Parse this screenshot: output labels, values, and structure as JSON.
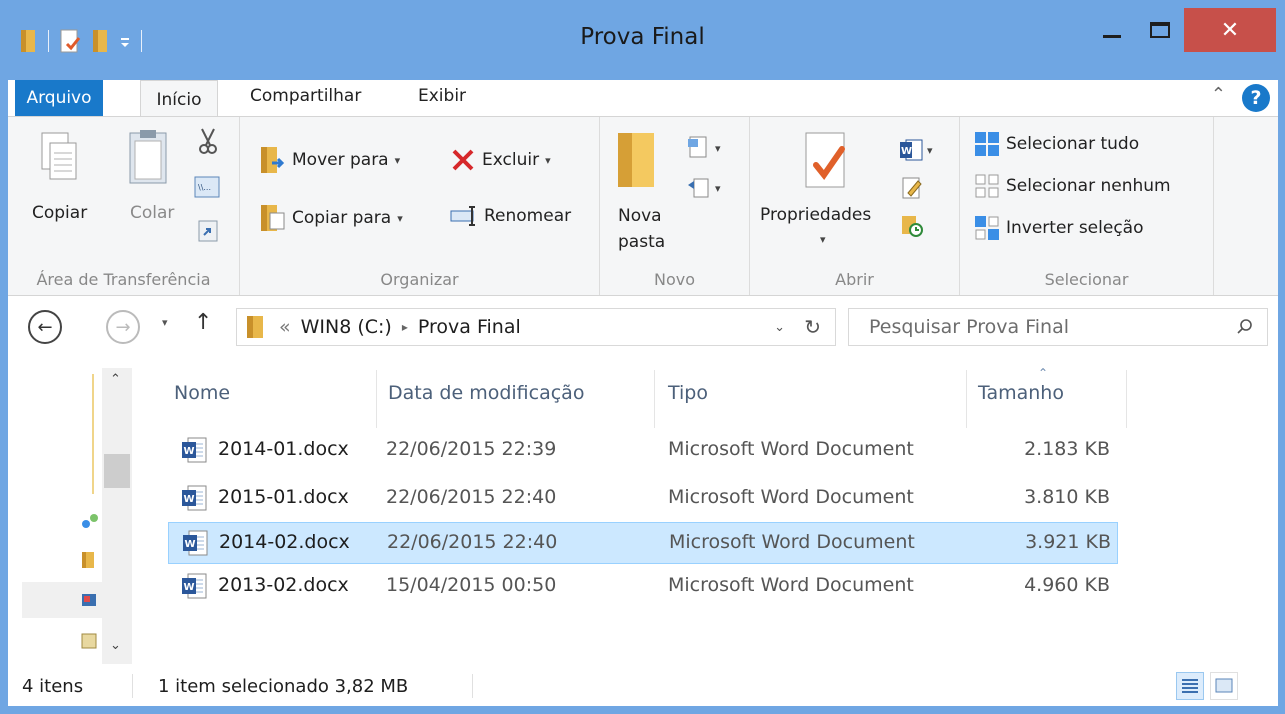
{
  "window": {
    "title": "Prova Final",
    "close_glyph": "✕"
  },
  "ribbon_tabs": {
    "file": "Arquivo",
    "home": "Início",
    "share": "Compartilhar",
    "view": "Exibir"
  },
  "clipboard": {
    "copy": "Copiar",
    "paste": "Colar",
    "group_label": "Área de Transferência"
  },
  "organize": {
    "move_to": "Mover para",
    "copy_to": "Copiar para",
    "delete": "Excluir",
    "rename": "Renomear",
    "group_label": "Organizar"
  },
  "new_group": {
    "new_folder_line1": "Nova",
    "new_folder_line2": "pasta",
    "group_label": "Novo"
  },
  "open_group": {
    "properties": "Propriedades",
    "group_label": "Abrir"
  },
  "select_group": {
    "select_all": "Selecionar tudo",
    "select_none": "Selecionar nenhum",
    "invert": "Inverter seleção",
    "group_label": "Selecionar"
  },
  "address": {
    "prefix": "«",
    "drive": "WIN8 (C:)",
    "separator": "▸",
    "folder": "Prova Final",
    "search_placeholder": "Pesquisar Prova Final"
  },
  "columns": {
    "name": "Nome",
    "date": "Data de modificação",
    "type": "Tipo",
    "size": "Tamanho"
  },
  "files": [
    {
      "name": "2014-01.docx",
      "date": "22/06/2015 22:39",
      "type": "Microsoft Word Document",
      "size": "2.183 KB",
      "selected": false
    },
    {
      "name": "2015-01.docx",
      "date": "22/06/2015 22:40",
      "type": "Microsoft Word Document",
      "size": "3.810 KB",
      "selected": false
    },
    {
      "name": "2014-02.docx",
      "date": "22/06/2015 22:40",
      "type": "Microsoft Word Document",
      "size": "3.921 KB",
      "selected": true
    },
    {
      "name": "2013-02.docx",
      "date": "15/04/2015 00:50",
      "type": "Microsoft Word Document",
      "size": "4.960 KB",
      "selected": false
    }
  ],
  "status": {
    "count": "4 itens",
    "selection": "1 item selecionado  3,82 MB"
  },
  "colors": {
    "titlebar": "#6fa6e3",
    "file_tab": "#1979ca",
    "close": "#c7504a",
    "selection": "#cce8ff"
  },
  "icons": [
    "folder-icon",
    "properties-icon",
    "new-folder-icon",
    "undo-icon",
    "dropdown-icon",
    "copy-icon",
    "paste-icon",
    "cut-icon",
    "copy-path-icon",
    "paste-shortcut-icon",
    "move-to-icon",
    "copy-to-icon",
    "delete-icon",
    "rename-icon",
    "new-item-icon",
    "easy-access-icon",
    "word-icon",
    "edit-icon",
    "history-icon",
    "select-all-icon",
    "select-none-icon",
    "invert-selection-icon",
    "back-icon",
    "forward-icon",
    "up-icon",
    "refresh-icon",
    "search-icon",
    "details-view-icon",
    "large-icons-view-icon"
  ]
}
